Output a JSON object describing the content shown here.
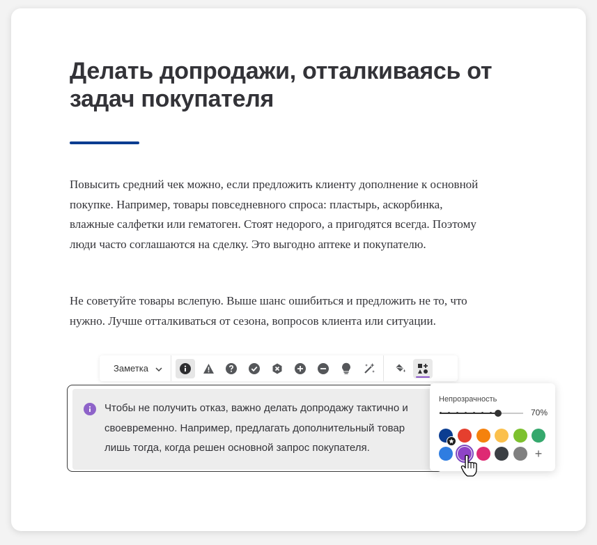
{
  "article": {
    "title": "Делать допродажи, отталкиваясь от задач покупателя",
    "accent_color": "#0b3d91",
    "paragraphs": [
      "Повысить средний чек можно, если предложить клиенту дополнение к основной покупке. Например, товары повседневного спроса: пластырь, аскорбинка, влажные салфетки или гематоген. Стоят недорого, а пригодятся всегда. Поэтому люди часто соглашаются на сделку. Это выгодно аптеке и покупателю.",
      "Не советуйте товары вслепую. Выше шанс ошибиться и предложить не то, что нужно. Лучше отталкиваться от сезона, вопросов клиента или ситуации."
    ]
  },
  "toolbar": {
    "block_type": "Заметка",
    "icons": [
      "info-icon",
      "warning-icon",
      "question-icon",
      "check-icon",
      "error-icon",
      "plus-icon",
      "minus-icon",
      "lightbulb-icon",
      "magic-wand-icon"
    ],
    "active_icon": "info-icon",
    "right_icons": [
      "fill-bucket-icon",
      "shapes-icon"
    ],
    "right_active": "shapes-icon"
  },
  "note": {
    "text": "Чтобы не получить отказ, важно делать допродажу тактично и своевременно. Например, предлагать дополнительный товар лишь тогда, когда решен основной запрос покупателя.",
    "icon": "info-icon",
    "icon_color": "#8e63c9"
  },
  "color_popover": {
    "opacity_label": "Непрозрачность",
    "opacity_value": "70%",
    "opacity_fraction": 0.7,
    "colors": [
      "#0b3d91",
      "#e53f2e",
      "#f5820d",
      "#fbc04c",
      "#7dc12e",
      "#35a86d",
      "#2f7de1",
      "#8e44c7",
      "#de2a73",
      "#3b3f44",
      "#808080"
    ],
    "selected_color": "#8e44c7",
    "default_color": "#0b3d91",
    "add_label": "+"
  }
}
